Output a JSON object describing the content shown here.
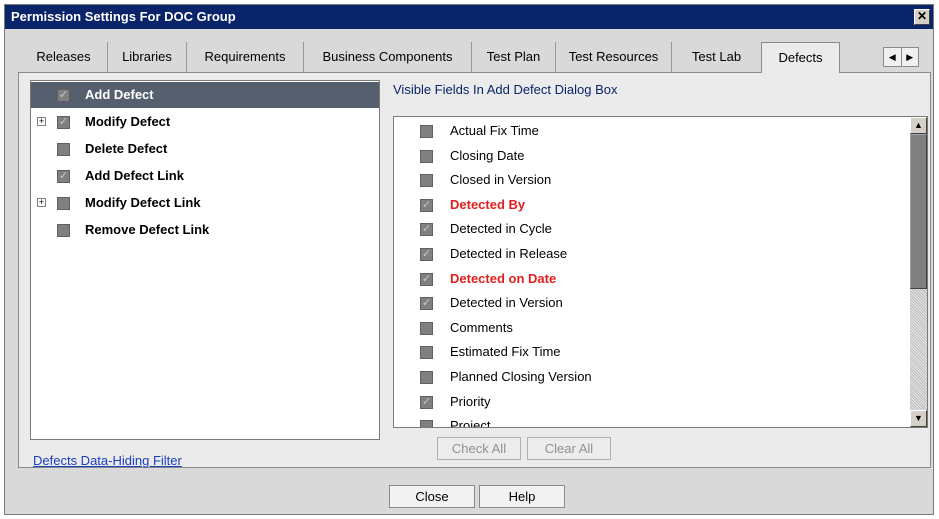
{
  "dialog": {
    "title": "Permission Settings For DOC Group",
    "close_glyph": "✕"
  },
  "tabs": [
    {
      "label": "Releases"
    },
    {
      "label": "Libraries"
    },
    {
      "label": "Requirements"
    },
    {
      "label": "Business Components"
    },
    {
      "label": "Test Plan"
    },
    {
      "label": "Test Resources"
    },
    {
      "label": "Test Lab"
    },
    {
      "label": "Defects",
      "active": true
    }
  ],
  "tab_scroll": {
    "left": "◀",
    "right": "▶"
  },
  "permissions": [
    {
      "label": "Add Defect",
      "checked": true,
      "selected": true,
      "expandable": false
    },
    {
      "label": "Modify Defect",
      "checked": true,
      "selected": false,
      "expandable": true
    },
    {
      "label": "Delete Defect",
      "checked": false,
      "selected": false,
      "expandable": false
    },
    {
      "label": "Add Defect Link",
      "checked": true,
      "selected": false,
      "expandable": false
    },
    {
      "label": "Modify Defect Link",
      "checked": false,
      "selected": false,
      "expandable": true
    },
    {
      "label": "Remove Defect Link",
      "checked": false,
      "selected": false,
      "expandable": false
    }
  ],
  "fields_heading": "Visible Fields In Add Defect Dialog Box",
  "fields": [
    {
      "label": "Actual Fix Time",
      "checked": false,
      "required": false
    },
    {
      "label": "Closing Date",
      "checked": false,
      "required": false
    },
    {
      "label": "Closed in Version",
      "checked": false,
      "required": false
    },
    {
      "label": "Detected By",
      "checked": true,
      "required": true
    },
    {
      "label": "Detected in Cycle",
      "checked": true,
      "required": false
    },
    {
      "label": "Detected in Release",
      "checked": true,
      "required": false
    },
    {
      "label": "Detected on Date",
      "checked": true,
      "required": true
    },
    {
      "label": "Detected in Version",
      "checked": true,
      "required": false
    },
    {
      "label": "Comments",
      "checked": false,
      "required": false
    },
    {
      "label": "Estimated Fix Time",
      "checked": false,
      "required": false
    },
    {
      "label": "Planned Closing Version",
      "checked": false,
      "required": false
    },
    {
      "label": "Priority",
      "checked": true,
      "required": false
    },
    {
      "label": "Project",
      "checked": false,
      "required": false
    }
  ],
  "scroll": {
    "up": "▲",
    "down": "▼"
  },
  "buttons": {
    "check_all": "Check All",
    "clear_all": "Clear All",
    "close": "Close",
    "help": "Help"
  },
  "link": {
    "hiding_filter": "Defects Data-Hiding Filter"
  },
  "glyphs": {
    "checkmark": "✓",
    "expand": "+"
  },
  "colors": {
    "selected_row": "#555f6e",
    "required_text": "#e01f1f",
    "title_bar": "#0a246a"
  }
}
